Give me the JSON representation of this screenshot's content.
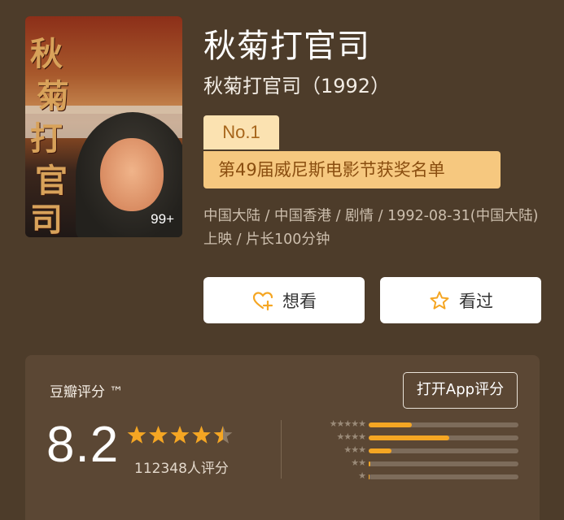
{
  "movie": {
    "title": "秋菊打官司",
    "original_title": "秋菊打官司（1992）",
    "poster_badge": "99+",
    "poster_glyphs": [
      "秋",
      "菊",
      "打",
      "官",
      "司"
    ],
    "rank_label": "No.1",
    "award_label": "第49届威尼斯电影节获奖名单",
    "meta": "中国大陆 / 中国香港 / 剧情 / 1992-08-31(中国大陆)上映 / 片长100分钟"
  },
  "actions": {
    "want_label": "想看",
    "seen_label": "看过"
  },
  "rating": {
    "title": "豆瓣评分 ™",
    "open_app_label": "打开App评分",
    "score": "8.2",
    "star_rating_out_of_5": 4.5,
    "count_text": "112348人评分",
    "distribution": [
      {
        "stars": "★★★★★",
        "fraction": 0.29
      },
      {
        "stars": "★★★★",
        "fraction": 0.54
      },
      {
        "stars": "★★★",
        "fraction": 0.15
      },
      {
        "stars": "★★",
        "fraction": 0.01
      },
      {
        "stars": "★",
        "fraction": 0.005
      }
    ]
  },
  "colors": {
    "background": "#4d3c2a",
    "panel": "#5b4734",
    "accent_star": "#f5a623",
    "rank_bg": "#fbe2b1",
    "award_bg": "#f6c87f"
  },
  "icons": {
    "want": "heart-plus-icon",
    "seen": "star-outline-icon"
  }
}
